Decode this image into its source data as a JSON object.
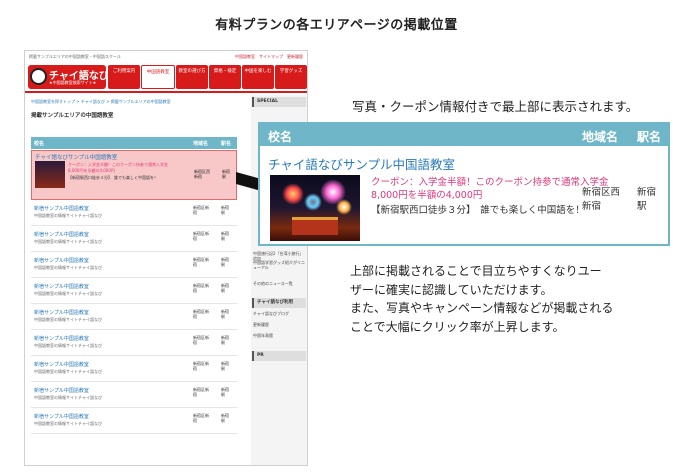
{
  "heading": "有料プランの各エリアページの掲載位置",
  "mock_site": {
    "top_line": "掲載サンプルエリアの中国語教室・中国語スクール",
    "top_links": "中国語教室　サイトマップ　更新履歴",
    "logo_text": "チャイ語なび",
    "logo_sub": "★中国語教室検索サイト★",
    "nav": [
      "ご利用案内",
      "中国語教室",
      "教室の選び方",
      "資格・検定",
      "中国を楽しむ",
      "学習グッズ"
    ],
    "breadcrumb": "中国語教室を探すトップ > チャイ語なび > 掲載サンプルエリアの中国語教室",
    "section_title": "掲載サンプルエリアの中国語教室",
    "table_headers": {
      "name": "校名",
      "area": "地域名",
      "station": "駅名"
    },
    "featured": {
      "name": "チャイ語なびサンプル中国語教室",
      "coupon_line1": "クーポン：入学金半額！このクーポン持参で通常入学金",
      "coupon_line2": "8,000円を半額の4,000円",
      "address": "【新宿駅西口徒歩３分】　誰でも楽しく中国語を！",
      "area_line1": "新宿区西",
      "area_line2": "新宿",
      "station_line1": "新宿",
      "station_line2": "駅"
    },
    "rows": [
      {
        "name": "新宿サンプル中国語教室",
        "desc": "中国語教室の情報サイトチャイ語なび",
        "area_line1": "新宿区新",
        "area_line2": "宿",
        "station_line1": "新宿",
        "station_line2": "駅"
      },
      {
        "name": "新宿サンプル中国語教室",
        "desc": "中国語教室の情報サイトチャイ語なび",
        "area_line1": "新宿区新",
        "area_line2": "宿",
        "station_line1": "新宿",
        "station_line2": "駅"
      },
      {
        "name": "新宿サンプル中国語教室",
        "desc": "中国語教室の情報サイトチャイ語なび",
        "area_line1": "新宿区新",
        "area_line2": "宿",
        "station_line1": "新宿",
        "station_line2": "駅"
      },
      {
        "name": "新宿サンプル中国語教室",
        "desc": "中国語教室の情報サイトチャイ語なび",
        "area_line1": "新宿区新",
        "area_line2": "宿",
        "station_line1": "新宿",
        "station_line2": "駅"
      },
      {
        "name": "新宿サンプル中国語教室",
        "desc": "中国語教室の情報サイトチャイ語なび",
        "area_line1": "新宿区新",
        "area_line2": "宿",
        "station_line1": "新宿",
        "station_line2": "駅"
      },
      {
        "name": "新宿サンプル中国語教室",
        "desc": "中国語教室の情報サイトチャイ語なび",
        "area_line1": "新宿区新",
        "area_line2": "宿",
        "station_line1": "新宿",
        "station_line2": "駅"
      },
      {
        "name": "新宿サンプル中国語教室",
        "desc": "中国語教室の情報サイトチャイ語なび",
        "area_line1": "新宿区新",
        "area_line2": "宿",
        "station_line1": "新宿",
        "station_line2": "駅"
      },
      {
        "name": "新宿サンプル中国語教室",
        "desc": "中国語教室の情報サイトチャイ語なび",
        "area_line1": "新宿区新",
        "area_line2": "宿",
        "station_line1": "新宿",
        "station_line2": "駅"
      },
      {
        "name": "新宿サンプル中国語教室",
        "desc": "中国語教室の情報サイトチャイ語なび",
        "area_line1": "新宿区新",
        "area_line2": "宿",
        "station_line1": "新宿",
        "station_line2": "駅"
      }
    ],
    "sidebar": {
      "special": "SPECIAL",
      "items1": [
        "中国旅行記2「台湾小旅行」追加",
        "中国語学習グッズ紹介がリニューアル",
        "その他のニュース一覧"
      ],
      "head2": "チャイ語なび利用",
      "items2": [
        "チャイ語なびブログ",
        "更新履歴",
        "中国年表館"
      ],
      "pr": "PR"
    }
  },
  "callout_note": "写真・クーポン情報付きで最上部に表示されます。",
  "callout": {
    "head_name": "校名",
    "head_area": "地域名",
    "head_station": "駅名",
    "name": "チャイ語なびサンプル中国語教室",
    "coupon_line1": "クーポン：入学金半額！このクーポン持参で通常入学金",
    "coupon_line2": "8,000円を半額の4,000円",
    "address": "【新宿駅西口徒歩３分】　誰でも楽しく中国語を！",
    "area_line1": "新宿区西",
    "area_line2": "新宿",
    "station_line1": "新宿",
    "station_line2": "駅"
  },
  "description": {
    "line1": "上部に掲載されることで目立ちやすくなりユー",
    "line2": "ザーに確実に認識していただけます。",
    "line3": "また、写真やキャンペーン情報などが掲載される",
    "line4": "ことで大幅にクリック率が上昇します。"
  },
  "colors": {
    "accent": "#d71b1b",
    "table_header": "#6fb7c8",
    "link": "#2a7ab8",
    "coupon": "#e0367a",
    "featured_bg": "#f8c8c8"
  }
}
